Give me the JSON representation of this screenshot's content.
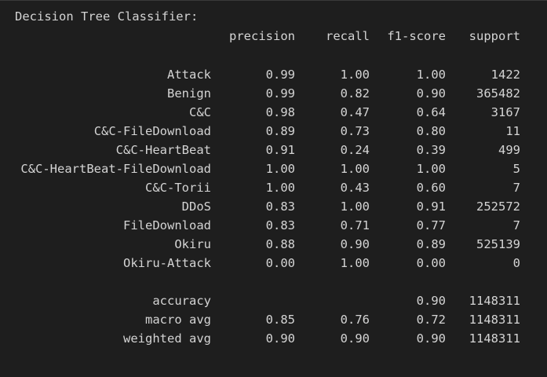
{
  "title": "Decision Tree Classifier:",
  "headers": {
    "precision": "precision",
    "recall": "recall",
    "f1": "f1-score",
    "support": "support"
  },
  "classes": [
    {
      "label": "Attack",
      "precision": "0.99",
      "recall": "1.00",
      "f1": "1.00",
      "support": "1422"
    },
    {
      "label": "Benign",
      "precision": "0.99",
      "recall": "0.82",
      "f1": "0.90",
      "support": "365482"
    },
    {
      "label": "C&C",
      "precision": "0.98",
      "recall": "0.47",
      "f1": "0.64",
      "support": "3167"
    },
    {
      "label": "C&C-FileDownload",
      "precision": "0.89",
      "recall": "0.73",
      "f1": "0.80",
      "support": "11"
    },
    {
      "label": "C&C-HeartBeat",
      "precision": "0.91",
      "recall": "0.24",
      "f1": "0.39",
      "support": "499"
    },
    {
      "label": "C&C-HeartBeat-FileDownload",
      "precision": "1.00",
      "recall": "1.00",
      "f1": "1.00",
      "support": "5"
    },
    {
      "label": "C&C-Torii",
      "precision": "1.00",
      "recall": "0.43",
      "f1": "0.60",
      "support": "7"
    },
    {
      "label": "DDoS",
      "precision": "0.83",
      "recall": "1.00",
      "f1": "0.91",
      "support": "252572"
    },
    {
      "label": "FileDownload",
      "precision": "0.83",
      "recall": "0.71",
      "f1": "0.77",
      "support": "7"
    },
    {
      "label": "Okiru",
      "precision": "0.88",
      "recall": "0.90",
      "f1": "0.89",
      "support": "525139"
    },
    {
      "label": "Okiru-Attack",
      "precision": "0.00",
      "recall": "1.00",
      "f1": "0.00",
      "support": "0"
    }
  ],
  "summary": {
    "accuracy": {
      "label": "accuracy",
      "f1": "0.90",
      "support": "1148311"
    },
    "macro_avg": {
      "label": "macro avg",
      "precision": "0.85",
      "recall": "0.76",
      "f1": "0.72",
      "support": "1148311"
    },
    "weighted_avg": {
      "label": "weighted avg",
      "precision": "0.90",
      "recall": "0.90",
      "f1": "0.90",
      "support": "1148311"
    }
  }
}
